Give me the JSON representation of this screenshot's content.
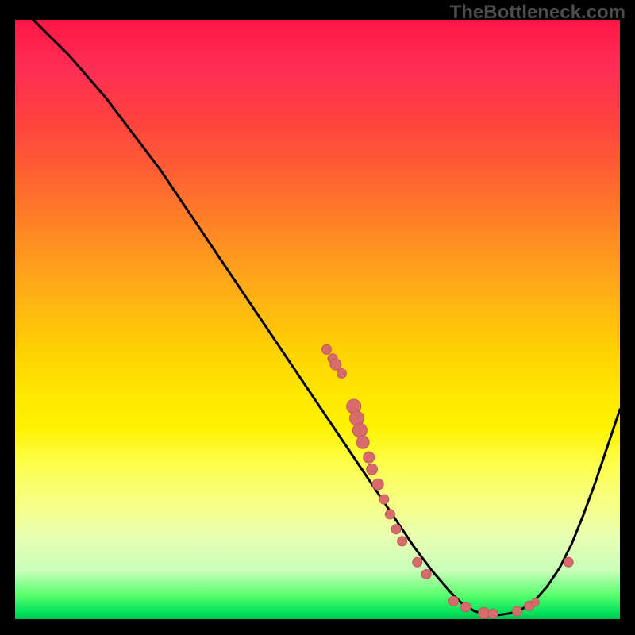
{
  "watermark": "TheBottleneck.com",
  "colors": {
    "curve": "#000000",
    "points": "#d86b6b",
    "points_stroke": "#c05858"
  },
  "chart_data": {
    "type": "line",
    "title": "",
    "xlabel": "",
    "ylabel": "",
    "xlim": [
      0,
      100
    ],
    "ylim": [
      0,
      100
    ],
    "curve": [
      {
        "x": 0,
        "y": 103
      },
      {
        "x": 3,
        "y": 100
      },
      {
        "x": 6,
        "y": 97
      },
      {
        "x": 9,
        "y": 94
      },
      {
        "x": 12,
        "y": 90.5
      },
      {
        "x": 15,
        "y": 87
      },
      {
        "x": 18,
        "y": 83
      },
      {
        "x": 21,
        "y": 79
      },
      {
        "x": 24,
        "y": 75
      },
      {
        "x": 27,
        "y": 70.5
      },
      {
        "x": 30,
        "y": 66
      },
      {
        "x": 33,
        "y": 61.5
      },
      {
        "x": 36,
        "y": 57
      },
      {
        "x": 39,
        "y": 52.5
      },
      {
        "x": 42,
        "y": 48
      },
      {
        "x": 45,
        "y": 43.5
      },
      {
        "x": 48,
        "y": 39
      },
      {
        "x": 51,
        "y": 34.5
      },
      {
        "x": 54,
        "y": 30
      },
      {
        "x": 57,
        "y": 25.5
      },
      {
        "x": 60,
        "y": 21
      },
      {
        "x": 63,
        "y": 16.5
      },
      {
        "x": 66,
        "y": 12
      },
      {
        "x": 69,
        "y": 8
      },
      {
        "x": 72,
        "y": 4.5
      },
      {
        "x": 74,
        "y": 2.5
      },
      {
        "x": 76,
        "y": 1.3
      },
      {
        "x": 78,
        "y": 0.8
      },
      {
        "x": 80,
        "y": 0.7
      },
      {
        "x": 82,
        "y": 1.0
      },
      {
        "x": 84,
        "y": 1.8
      },
      {
        "x": 86,
        "y": 3.2
      },
      {
        "x": 88,
        "y": 5.5
      },
      {
        "x": 90,
        "y": 8.5
      },
      {
        "x": 92,
        "y": 12.5
      },
      {
        "x": 94,
        "y": 17.5
      },
      {
        "x": 96,
        "y": 23
      },
      {
        "x": 98,
        "y": 29
      },
      {
        "x": 100,
        "y": 35
      }
    ],
    "series": [
      {
        "name": "points",
        "values": [
          {
            "x": 51.5,
            "y": 45.0,
            "r": 6
          },
          {
            "x": 52.5,
            "y": 43.5,
            "r": 6
          },
          {
            "x": 53.0,
            "y": 42.5,
            "r": 7
          },
          {
            "x": 54.0,
            "y": 41.0,
            "r": 6
          },
          {
            "x": 56.0,
            "y": 35.5,
            "r": 9
          },
          {
            "x": 56.5,
            "y": 33.5,
            "r": 9
          },
          {
            "x": 57.0,
            "y": 31.5,
            "r": 9
          },
          {
            "x": 57.5,
            "y": 29.5,
            "r": 8
          },
          {
            "x": 58.5,
            "y": 27.0,
            "r": 7
          },
          {
            "x": 59.0,
            "y": 25.0,
            "r": 7
          },
          {
            "x": 60.0,
            "y": 22.5,
            "r": 7
          },
          {
            "x": 61.0,
            "y": 20.0,
            "r": 6
          },
          {
            "x": 62.0,
            "y": 17.5,
            "r": 6
          },
          {
            "x": 63.0,
            "y": 15.0,
            "r": 6
          },
          {
            "x": 64.0,
            "y": 13.0,
            "r": 6
          },
          {
            "x": 66.5,
            "y": 9.5,
            "r": 6
          },
          {
            "x": 68.0,
            "y": 7.5,
            "r": 6
          },
          {
            "x": 72.5,
            "y": 3.0,
            "r": 6
          },
          {
            "x": 74.5,
            "y": 2.0,
            "r": 6
          },
          {
            "x": 77.5,
            "y": 1.0,
            "r": 7
          },
          {
            "x": 79.0,
            "y": 0.9,
            "r": 6
          },
          {
            "x": 83.0,
            "y": 1.3,
            "r": 6
          },
          {
            "x": 85.0,
            "y": 2.2,
            "r": 6
          },
          {
            "x": 86.0,
            "y": 2.8,
            "r": 5
          },
          {
            "x": 91.5,
            "y": 9.5,
            "r": 6
          }
        ]
      }
    ]
  }
}
